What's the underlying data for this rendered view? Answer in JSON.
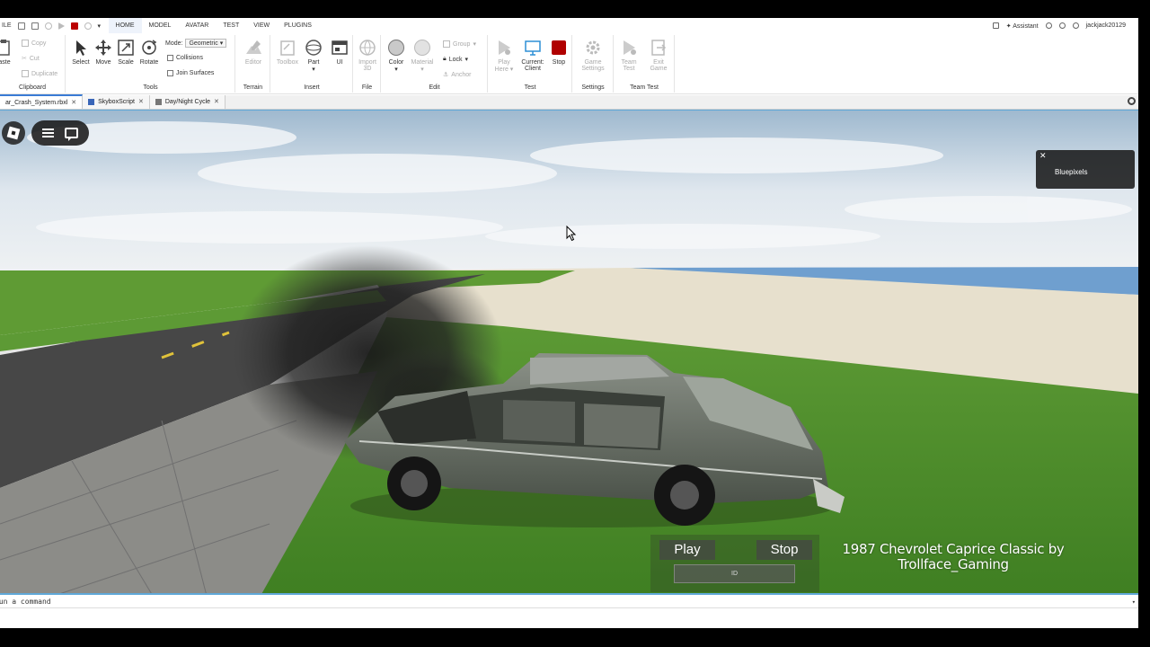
{
  "menubar": {
    "file_label": "ILE",
    "tabs": [
      {
        "label": "HOME",
        "active": true
      },
      {
        "label": "MODEL",
        "active": false
      },
      {
        "label": "AVATAR",
        "active": false
      },
      {
        "label": "TEST",
        "active": false
      },
      {
        "label": "VIEW",
        "active": false
      },
      {
        "label": "PLUGINS",
        "active": false
      }
    ],
    "assistant_label": "Assistant",
    "username": "jackjack20129"
  },
  "ribbon": {
    "clipboard": {
      "paste": "aste",
      "copy": "Copy",
      "cut": "Cut",
      "duplicate": "Duplicate",
      "label": "Clipboard"
    },
    "tools": {
      "select": "Select",
      "move": "Move",
      "scale": "Scale",
      "rotate": "Rotate",
      "mode_label": "Mode:",
      "mode_value": "Geometric",
      "collisions": "Collisions",
      "join_surfaces": "Join Surfaces",
      "label": "Tools"
    },
    "terrain": {
      "editor": "Editor",
      "label": "Terrain"
    },
    "insert": {
      "toolbox": "Toolbox",
      "part": "Part",
      "ui": "UI",
      "label": "Insert"
    },
    "file": {
      "import_3d_line1": "Import",
      "import_3d_line2": "3D",
      "label": "File"
    },
    "edit": {
      "color": "Color",
      "material": "Material",
      "group": "Group",
      "lock": "Lock",
      "anchor": "Anchor",
      "label": "Edit"
    },
    "test": {
      "play_here_line1": "Play",
      "play_here_line2": "Here",
      "current_client_line1": "Current:",
      "current_client_line2": "Client",
      "stop": "Stop",
      "label": "Test"
    },
    "settings": {
      "game_settings_line1": "Game",
      "game_settings_line2": "Settings",
      "label": "Settings"
    },
    "team_test": {
      "team_test_line1": "Team",
      "team_test_line2": "Test",
      "exit_game_line1": "Exit",
      "exit_game_line2": "Game",
      "label": "Team Test"
    }
  },
  "doc_tabs": [
    {
      "label": "ar_Crash_System.rbxl",
      "active": true
    },
    {
      "label": "SkyboxScript",
      "active": false
    },
    {
      "label": "Day/Night Cycle",
      "active": false
    }
  ],
  "viewport": {
    "player_card": {
      "close": "✕",
      "name": "Bluepixels"
    },
    "play_button": "Play",
    "stop_button": "Stop",
    "id_field": "ID",
    "caption": "1987 Chevrolet Caprice Classic by Trollface_Gaming"
  },
  "command_bar": {
    "placeholder": "Run a command"
  },
  "colors": {
    "accent": "#3a7bd5",
    "stop_red": "#b00000",
    "sky": "#b9cfe0",
    "grass": "#4f8f2c",
    "sand": "#e8e1cf",
    "road": "#4a4a4a"
  }
}
